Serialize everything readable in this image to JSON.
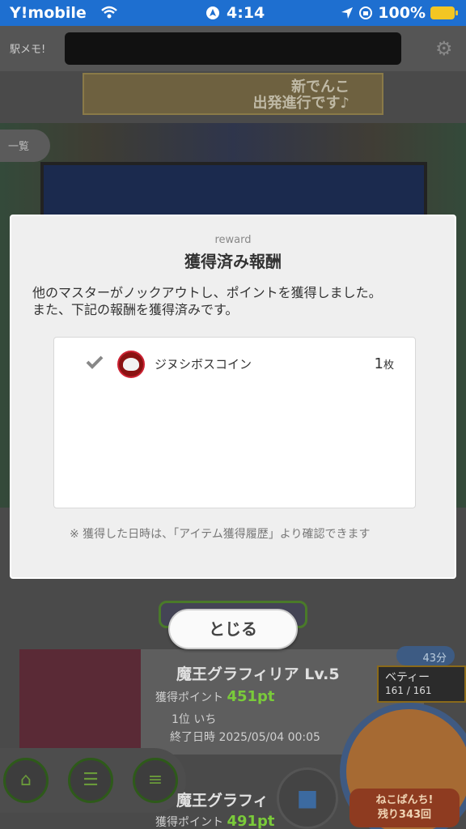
{
  "status_bar": {
    "carrier": "Y!mobile",
    "time": "4:14",
    "battery": "100%"
  },
  "background": {
    "logo": "駅メモ!",
    "banner": "新でんこ\n出発進行です♪",
    "back_tab": "一覧",
    "time_left_badge": "43分",
    "boss_name": "魔王グラフィリア Lv.5",
    "points_label": "獲得ポイント",
    "points_value": "451pt",
    "rank_label": "1位 いち",
    "end_label": "終了日時 2025/05/04 00:05",
    "partner_name": "ベティー",
    "partner_hp": "161 / 161",
    "neko_label": "ねこぱんち!\n残り343回",
    "boss_name_2": "魔王グラフィ",
    "points_label_2": "獲得ポイント",
    "points_value_2": "491pt"
  },
  "modal": {
    "subtitle": "reward",
    "title": "獲得済み報酬",
    "message_line1": "他のマスターがノックアウトし、ポイントを獲得しました。",
    "message_line2": "また、下記の報酬を獲得済みです。",
    "items": [
      {
        "name": "ジヌシボスコイン",
        "qty": "1",
        "unit": "枚",
        "icon": "boss-coin-icon"
      }
    ],
    "note": "※ 獲得した日時は、「アイテム獲得履歴」より確認できます"
  },
  "close_button": {
    "label": "とじる"
  }
}
